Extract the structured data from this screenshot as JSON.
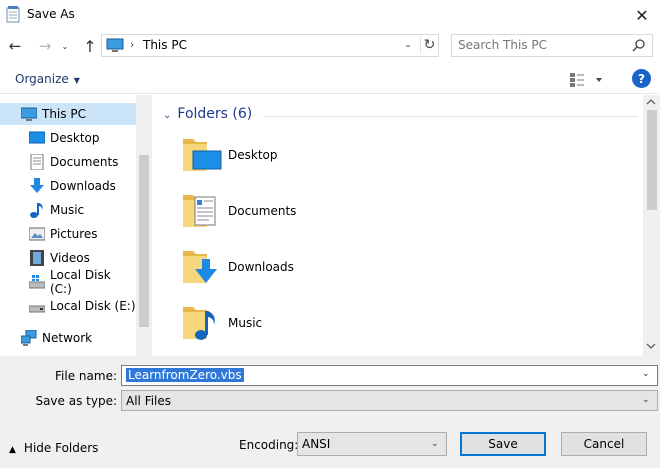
{
  "window": {
    "title": "Save As",
    "close_glyph": "✕"
  },
  "nav": {
    "back_glyph": "←",
    "forward_glyph": "→",
    "recent_glyph": "⌄",
    "up_glyph": "↑",
    "address": {
      "separator": "›",
      "location": "This PC",
      "dropdown_glyph": "⌄",
      "refresh_glyph": "↻"
    },
    "search": {
      "placeholder": "Search This PC"
    }
  },
  "toolbar": {
    "organize_label": "Organize",
    "organize_caret": "▼",
    "help_glyph": "?"
  },
  "sidebar": {
    "items": [
      {
        "label": "This PC",
        "icon": "computer-icon"
      },
      {
        "label": "Desktop",
        "icon": "desktop-icon"
      },
      {
        "label": "Documents",
        "icon": "documents-icon"
      },
      {
        "label": "Downloads",
        "icon": "downloads-icon"
      },
      {
        "label": "Music",
        "icon": "music-icon"
      },
      {
        "label": "Pictures",
        "icon": "pictures-icon"
      },
      {
        "label": "Videos",
        "icon": "videos-icon"
      },
      {
        "label": "Local Disk (C:)",
        "icon": "drive-icon"
      },
      {
        "label": "Local Disk (E:)",
        "icon": "drive-icon"
      },
      {
        "label": "Network",
        "icon": "network-icon"
      }
    ],
    "selected": "This PC"
  },
  "main": {
    "group_chevron": "⌄",
    "group_label": "Folders (6)",
    "folders": [
      {
        "label": "Desktop",
        "icon": "folder-desktop-icon"
      },
      {
        "label": "Documents",
        "icon": "folder-documents-icon"
      },
      {
        "label": "Downloads",
        "icon": "folder-downloads-icon"
      },
      {
        "label": "Music",
        "icon": "folder-music-icon"
      }
    ]
  },
  "form": {
    "filename_label": "File name:",
    "filename_value": "LearnfromZero.vbs",
    "savetype_label": "Save as type:",
    "savetype_value": "All Files",
    "dropdown_glyph": "⌄",
    "hide_folders_caret": "▲",
    "hide_folders_label": "Hide Folders",
    "encoding_label": "Encoding:",
    "encoding_value": "ANSI",
    "save_label": "Save",
    "cancel_label": "Cancel"
  },
  "colors": {
    "accent": "#0078d7",
    "selection": "#cce4f7",
    "link_text": "#1e3a6e",
    "group_header": "#1e3a8a"
  }
}
